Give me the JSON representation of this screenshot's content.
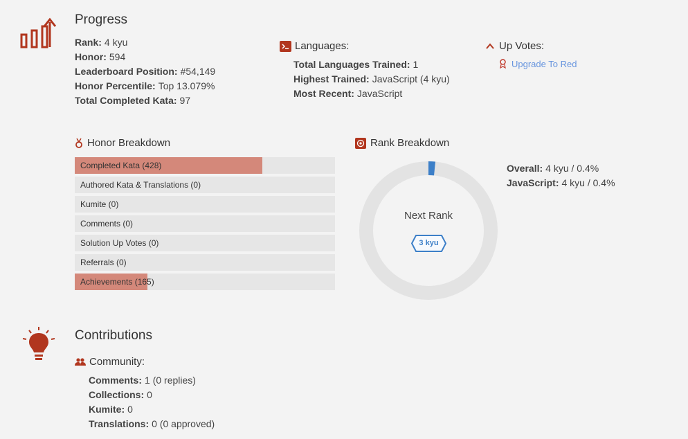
{
  "progress": {
    "title": "Progress",
    "stats": [
      {
        "label": "Rank:",
        "value": "4 kyu"
      },
      {
        "label": "Honor:",
        "value": "594"
      },
      {
        "label": "Leaderboard Position:",
        "value": "#54,149"
      },
      {
        "label": "Honor Percentile:",
        "value": "Top 13.079%"
      },
      {
        "label": "Total Completed Kata:",
        "value": "97"
      }
    ]
  },
  "languages": {
    "title": "Languages:",
    "stats": [
      {
        "label": "Total Languages Trained:",
        "value": "1"
      },
      {
        "label": "Highest Trained:",
        "value": "JavaScript (4 kyu)"
      },
      {
        "label": "Most Recent:",
        "value": "JavaScript"
      }
    ]
  },
  "upvotes": {
    "title": "Up Votes:",
    "link": "Upgrade To Red"
  },
  "honor_breakdown": {
    "title": "Honor Breakdown",
    "items": [
      {
        "label": "Completed Kata (428)",
        "fill": 0.72
      },
      {
        "label": "Authored Kata & Translations (0)",
        "fill": 0
      },
      {
        "label": "Kumite (0)",
        "fill": 0
      },
      {
        "label": "Comments (0)",
        "fill": 0
      },
      {
        "label": "Solution Up Votes (0)",
        "fill": 0
      },
      {
        "label": "Referrals (0)",
        "fill": 0
      },
      {
        "label": "Achievements (165)",
        "fill": 0.28
      }
    ]
  },
  "rank_breakdown": {
    "title": "Rank Breakdown",
    "next_rank_label": "Next Rank",
    "next_rank_badge": "3 kyu",
    "progress": 0.004,
    "stats": [
      {
        "label": "Overall:",
        "value": "4 kyu / 0.4%"
      },
      {
        "label": "JavaScript:",
        "value": "4 kyu / 0.4%"
      }
    ]
  },
  "contributions": {
    "title": "Contributions",
    "community_title": "Community:",
    "stats": [
      {
        "label": "Comments:",
        "value": "1 (0 replies)"
      },
      {
        "label": "Collections:",
        "value": "0"
      },
      {
        "label": "Kumite:",
        "value": "0"
      },
      {
        "label": "Translations:",
        "value": "0 (0 approved)"
      }
    ]
  },
  "colors": {
    "accent": "#b1361e",
    "bar_fill": "#d4887a",
    "track": "#e6e6e6",
    "link": "#6795de",
    "ring_progress": "#3c7fc8"
  }
}
